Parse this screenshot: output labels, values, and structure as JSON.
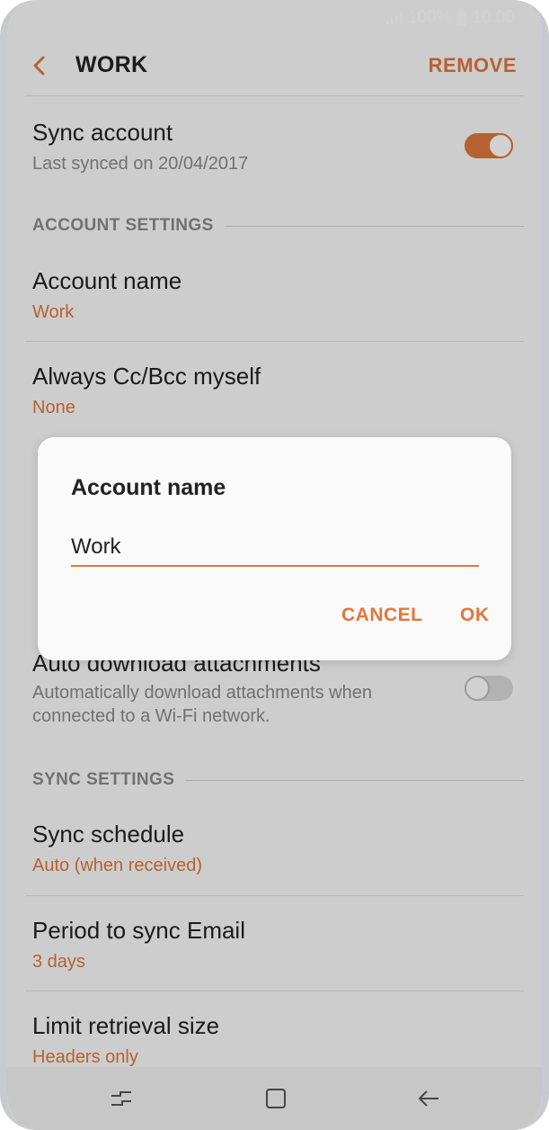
{
  "status_bar": {
    "battery": "100%",
    "time": "10:00"
  },
  "header": {
    "title": "WORK",
    "remove_label": "REMOVE"
  },
  "sync_account": {
    "label": "Sync account",
    "subtitle": "Last synced on 20/04/2017",
    "enabled": true
  },
  "account_settings": {
    "section_label": "ACCOUNT SETTINGS",
    "account_name": {
      "label": "Account name",
      "value": "Work"
    },
    "always_cc": {
      "label": "Always Cc/Bcc myself",
      "value": "None"
    },
    "auto_download": {
      "label": "Auto download attachments",
      "subtitle": "Automatically download attachments when connected to a Wi-Fi network.",
      "enabled": false
    }
  },
  "sync_settings": {
    "section_label": "SYNC SETTINGS",
    "sync_schedule": {
      "label": "Sync schedule",
      "value": "Auto (when received)"
    },
    "period": {
      "label": "Period to sync Email",
      "value": "3 days"
    },
    "limit": {
      "label": "Limit retrieval size",
      "value": "Headers only"
    }
  },
  "dialog": {
    "title": "Account name",
    "input_value": "Work",
    "cancel_label": "CANCEL",
    "ok_label": "OK"
  },
  "colors": {
    "accent": "#e0773d"
  },
  "icons": {
    "back": "chevron-left-icon",
    "recents": "recent-apps-icon",
    "home": "home-icon",
    "nav_back": "back-arrow-icon"
  }
}
